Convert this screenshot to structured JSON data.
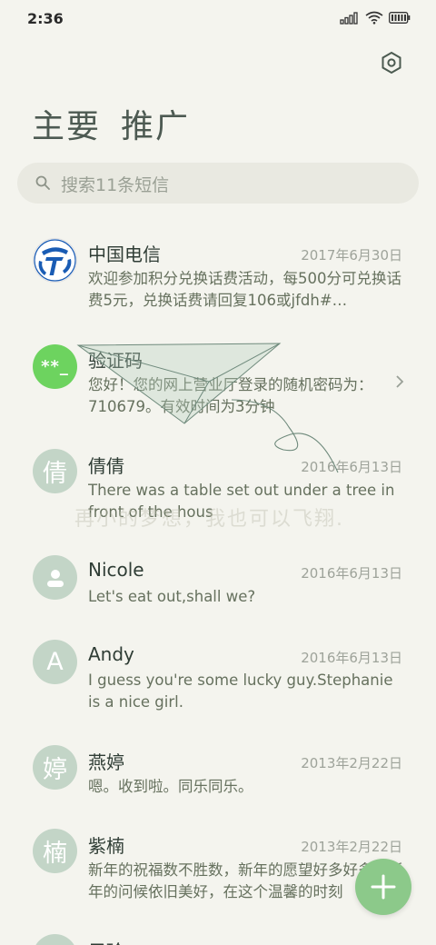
{
  "status": {
    "time": "2:36"
  },
  "tabs": [
    "主要",
    "推广"
  ],
  "search": {
    "placeholder": "搜索11条短信"
  },
  "watermark": "再小的梦想，我也可以飞翔.",
  "colors": {
    "accent": "#8cc98a",
    "avatar_bg": "#c3d5c7",
    "green_avatar": "#6dd35f",
    "background": "#f4f4ee"
  },
  "messages": [
    {
      "name": "中国电信",
      "date": "2017年6月30日",
      "avatar_text": "",
      "avatar_icon": "china-telecom-logo-icon",
      "preview": "欢迎参加积分兑换话费活动，每500分可兑换话费5元，兑换话费请回复106或jfdh#…"
    },
    {
      "name": "验证码",
      "date": "",
      "avatar_text": "**_",
      "avatar_icon": "",
      "preview": "您好！您的网上营业厅登录的随机密码为：710679。有效时间为3分钟"
    },
    {
      "name": "倩倩",
      "date": "2016年6月13日",
      "avatar_text": "倩",
      "avatar_icon": "",
      "preview": "There was a table set out under a tree in front of the hous"
    },
    {
      "name": "Nicole",
      "date": "2016年6月13日",
      "avatar_text": "",
      "avatar_icon": "person-icon",
      "preview": "Let's eat out,shall we?"
    },
    {
      "name": "Andy",
      "date": "2016年6月13日",
      "avatar_text": "A",
      "avatar_icon": "",
      "preview": "I guess you're some lucky guy.Stephanie is a nice girl."
    },
    {
      "name": "燕婷",
      "date": "2013年2月22日",
      "avatar_text": "婷",
      "avatar_icon": "",
      "preview": "嗯。收到啦。同乐同乐。"
    },
    {
      "name": "紫楠",
      "date": "2013年2月22日",
      "avatar_text": "楠",
      "avatar_icon": "",
      "preview": "新年的祝福数不胜数，新年的愿望好多好多，新年的问候依旧美好，在这个温馨的时刻"
    },
    {
      "name": "子玲",
      "date": "",
      "avatar_text": "",
      "avatar_icon": "",
      "preview": ""
    }
  ]
}
